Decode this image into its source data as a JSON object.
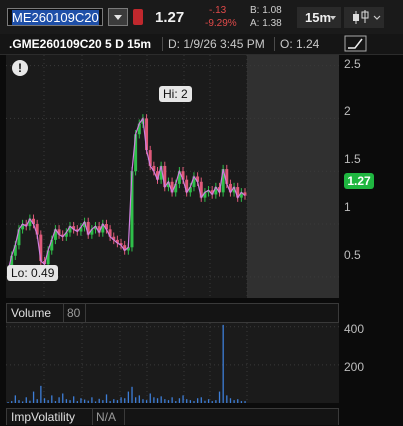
{
  "toolbar": {
    "symbol": "ME260109C20",
    "last_price": "1.27",
    "change_abs": "-.13",
    "change_pct": "-9.29%",
    "bid": "B: 1.08",
    "ask": "A: 1.38",
    "timeframe": "15m"
  },
  "info": {
    "symbol_line": ".GME260109C20 5 D 15m",
    "date": "D: 1/9/26 3:45 PM",
    "open": "O: 1.24"
  },
  "price_pane": {
    "hi_label": "Hi: 2",
    "lo_label": "Lo: 0.49",
    "current_tag": "1.27",
    "axis_ticks": [
      "2.5",
      "2",
      "1.5",
      "1",
      "0.5"
    ]
  },
  "volume_pane": {
    "label": "Volume",
    "value": "80",
    "axis_ticks": [
      "400",
      "200"
    ]
  },
  "iv_pane": {
    "label": "ImpVolatility",
    "value": "N/A"
  },
  "colors": {
    "up": "#2fbf4a",
    "down": "#e05a7a",
    "line": "#d07fe0",
    "vol": "#3d7ed8"
  },
  "chart_data": {
    "type": "line",
    "title": ".GME260109C20 5 D 15m",
    "ylim": [
      0.3,
      2.6
    ],
    "y_ticks": [
      2.5,
      2,
      1.5,
      1,
      0.5
    ],
    "series": [
      {
        "values": [
          0.55,
          0.7,
          0.8,
          0.95,
          1.0,
          0.98,
          1.05,
          1.0,
          0.9,
          0.65,
          0.62,
          0.75,
          0.85,
          0.95,
          0.9,
          0.88,
          0.92,
          0.98,
          0.95,
          0.93,
          0.97,
          1.02,
          0.9,
          0.95,
          0.98,
          0.92,
          1.0,
          0.95,
          0.88,
          0.85,
          0.82,
          0.8,
          0.75,
          0.78,
          1.5,
          1.85,
          1.95,
          2.0,
          1.7,
          1.55,
          1.5,
          1.42,
          1.55,
          1.35,
          1.4,
          1.3,
          1.38,
          1.5,
          1.42,
          1.3,
          1.35,
          1.45,
          1.4,
          1.25,
          1.3,
          1.32,
          1.28,
          1.35,
          1.3,
          1.52,
          1.38,
          1.3,
          1.35,
          1.25,
          1.3,
          1.27
        ]
      }
    ],
    "volume": {
      "ylim": [
        0,
        420
      ],
      "values": [
        5,
        10,
        40,
        15,
        8,
        30,
        12,
        60,
        20,
        90,
        25,
        15,
        40,
        10,
        30,
        50,
        20,
        15,
        35,
        10,
        25,
        18,
        12,
        30,
        8,
        22,
        15,
        45,
        10,
        20,
        15,
        30,
        25,
        60,
        85,
        30,
        40,
        20,
        15,
        50,
        30,
        25,
        35,
        20,
        15,
        30,
        10,
        25,
        40,
        20,
        15,
        10,
        25,
        30,
        12,
        20,
        10,
        15,
        60,
        410,
        40,
        25,
        15,
        20,
        10,
        10
      ]
    }
  }
}
